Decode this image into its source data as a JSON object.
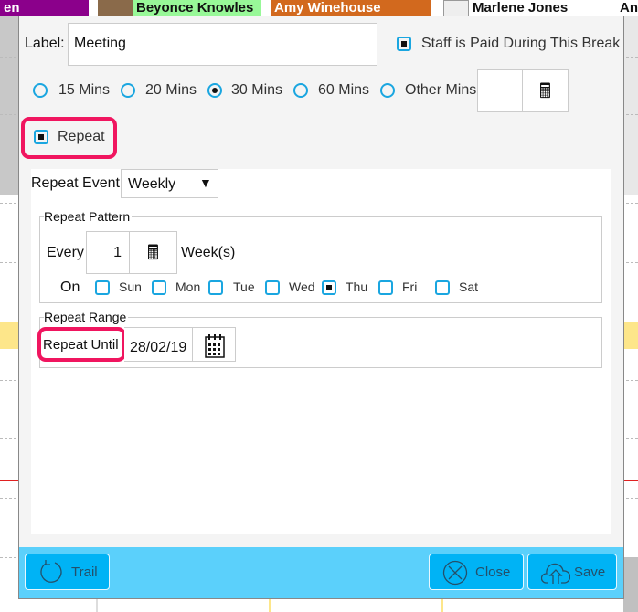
{
  "background": {
    "headers": [
      {
        "name": "en",
        "color": "#8b008b",
        "text_color": "#ffffff"
      },
      {
        "name": "Beyonce Knowles",
        "color": "#98f898",
        "text_color": "#111111"
      },
      {
        "name": "Amy Winehouse",
        "color": "#d2691e",
        "text_color": "#ffffff"
      },
      {
        "name": "Marlene Jones",
        "color": "#ffffff",
        "text_color": "#111111"
      },
      {
        "name": "And",
        "color": "#ffffff",
        "text_color": "#111111"
      }
    ]
  },
  "dialog": {
    "label_caption": "Label:",
    "label_value": "Meeting",
    "paid_label": "Staff is Paid During This Break",
    "paid_checked": true,
    "durations": [
      {
        "label": "15 Mins",
        "selected": false
      },
      {
        "label": "20 Mins",
        "selected": false
      },
      {
        "label": "30 Mins",
        "selected": true
      },
      {
        "label": "60 Mins",
        "selected": false
      },
      {
        "label": "Other Mins",
        "selected": false
      }
    ],
    "other_mins_value": "",
    "repeat_label": "Repeat",
    "repeat_checked": true,
    "repeat_event_label": "Repeat Event",
    "repeat_event_value": "Weekly",
    "pattern": {
      "title": "Repeat Pattern",
      "every_label": "Every",
      "every_value": "1",
      "unit": "Week(s)",
      "on_label": "On",
      "days": [
        {
          "label": "Sun",
          "checked": false
        },
        {
          "label": "Mon",
          "checked": false
        },
        {
          "label": "Tue",
          "checked": false
        },
        {
          "label": "Wed",
          "checked": false
        },
        {
          "label": "Thu",
          "checked": true
        },
        {
          "label": "Fri",
          "checked": false
        },
        {
          "label": "Sat",
          "checked": false
        }
      ]
    },
    "range": {
      "title": "Repeat Range",
      "until_label": "Repeat Until",
      "until_value": "28/02/19"
    },
    "footer": {
      "trail": "Trail",
      "close": "Close",
      "save": "Save"
    },
    "colors": {
      "accent": "#1aa6e0",
      "footer": "#5bd0fb",
      "button": "#00b3f5",
      "highlight": "#f0155f"
    }
  }
}
